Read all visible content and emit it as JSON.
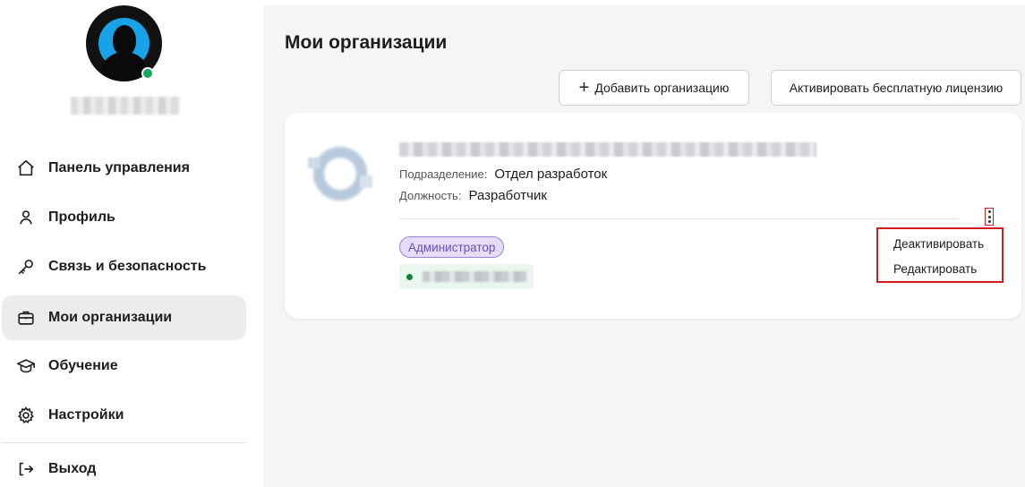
{
  "sidebar": {
    "nav": [
      {
        "label": "Панель управления",
        "icon": "home-icon"
      },
      {
        "label": "Профиль",
        "icon": "user-icon"
      },
      {
        "label": "Связь и безопасность",
        "icon": "key-icon"
      },
      {
        "label": "Мои организации",
        "icon": "briefcase-icon",
        "active": true
      },
      {
        "label": "Обучение",
        "icon": "graduation-cap-icon"
      },
      {
        "label": "Настройки",
        "icon": "gear-icon"
      },
      {
        "label": "Выход",
        "icon": "logout-icon"
      }
    ]
  },
  "main": {
    "title": "Мои организации",
    "add_button": "Добавить организацию",
    "license_button": "Активировать бесплатную лицензию",
    "org": {
      "department_label": "Подразделение:",
      "department_value": "Отдел разработок",
      "position_label": "Должность:",
      "position_value": "Разработчик",
      "role": "Администратор"
    },
    "menu": {
      "deactivate": "Деактивировать",
      "edit": "Редактировать"
    }
  },
  "colors": {
    "accent_highlight": "#d51c1c",
    "online": "#1aa260",
    "role_badge_bg": "#e5dcf7",
    "role_badge_text": "#6a4fb8",
    "active_nav_bg": "#ececec"
  }
}
